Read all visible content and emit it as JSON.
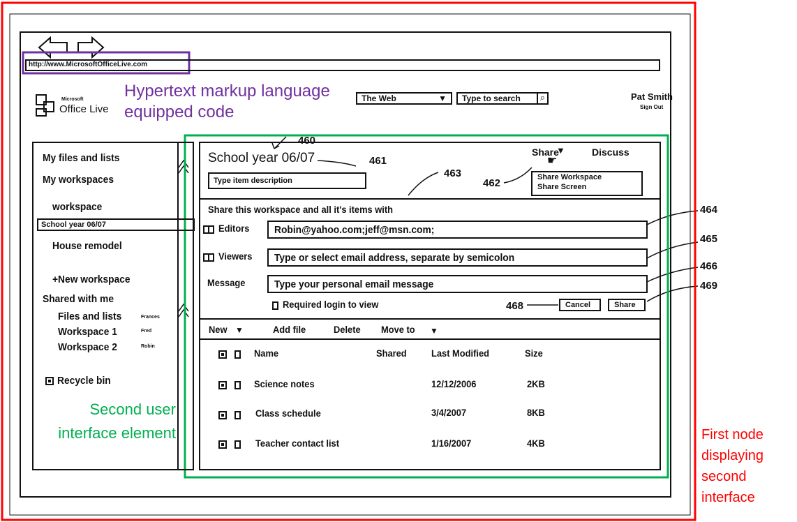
{
  "browser": {
    "url": "http://www.MicrosoftOfficeLive.com"
  },
  "header": {
    "logo_small": "Microsoft",
    "logo_large": "Office Live",
    "search_scope": "The Web",
    "search_placeholder": "Type to search",
    "user_name": "Pat Smith",
    "sign_out": "Sign Out"
  },
  "sidebar": {
    "files_and_lists": "My files and lists",
    "my_workspaces": "My workspaces",
    "workspace": "workspace",
    "selected": "School year 06/07",
    "house_remodel": "House remodel",
    "new_workspace": "+New workspace",
    "shared_with_me": "Shared with me",
    "shared_items": [
      {
        "label": "Files and lists",
        "owner": "Frances"
      },
      {
        "label": "Workspace 1",
        "owner": "Fred"
      },
      {
        "label": "Workspace 2",
        "owner": "Robin"
      }
    ],
    "recycle_bin": "Recycle bin"
  },
  "main": {
    "title": "School year 06/07",
    "description_placeholder": "Type item description",
    "share_menu": "Share",
    "discuss": "Discuss",
    "share_options": [
      "Share Workspace",
      "Share Screen"
    ],
    "share_heading": "Share this workspace and all it's items with",
    "editors_label": "Editors",
    "editors_value": "Robin@yahoo.com;jeff@msn.com;",
    "viewers_label": "Viewers",
    "viewers_placeholder": "Type or select email address, separate by semicolon",
    "message_label": "Message",
    "message_placeholder": "Type your personal email message",
    "required_login": "Required login to view",
    "cancel": "Cancel",
    "share_button": "Share",
    "toolbar": {
      "new": "New",
      "add_file": "Add file",
      "delete": "Delete",
      "move_to": "Move to"
    },
    "columns": [
      "Name",
      "Shared",
      "Last Modified",
      "Size"
    ],
    "rows": [
      {
        "name": "Science notes",
        "shared": "",
        "modified": "12/12/2006",
        "size": "2KB"
      },
      {
        "name": "Class schedule",
        "shared": "",
        "modified": "3/4/2007",
        "size": "8KB"
      },
      {
        "name": "Teacher contact list",
        "shared": "",
        "modified": "1/16/2007",
        "size": "4KB"
      }
    ]
  },
  "references": {
    "r460": "460",
    "r461": "461",
    "r462": "462",
    "r463": "463",
    "r464": "464",
    "r465": "465",
    "r466": "466",
    "r468": "468",
    "r469": "469"
  },
  "annotations": {
    "purple": "Hypertext markup language equipped code",
    "green": "Second user interface element",
    "red": "First node displaying second interface",
    "colors": {
      "purple": "#7030a0",
      "green": "#00b050",
      "red": "#ff0000"
    }
  }
}
